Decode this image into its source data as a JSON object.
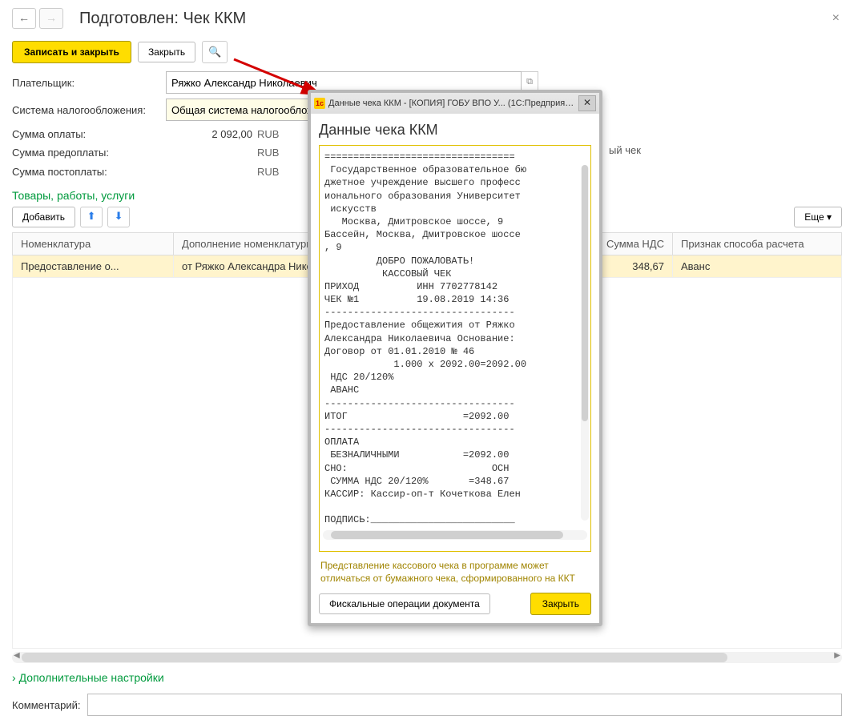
{
  "header": {
    "title": "Подготовлен: Чек ККМ"
  },
  "toolbar": {
    "save_close": "Записать и закрыть",
    "close": "Закрыть"
  },
  "form": {
    "payer_label": "Плательщик:",
    "payer_value": "Ряжко Александр Николаевич",
    "tax_label": "Система налогообложения:",
    "tax_value": "Общая система налогооблож",
    "sum_pay_label": "Сумма оплаты:",
    "sum_pay_value": "2 092,00",
    "cur": "RUB",
    "sum_prepay_label": "Сумма предоплаты:",
    "sum_postpay_label": "Сумма постоплаты:",
    "print_hint": "ый чек"
  },
  "section": {
    "goods": "Товары, работы, услуги",
    "add": "Добавить",
    "more": "Еще"
  },
  "table": {
    "h_nom": "Номенклатура",
    "h_dop": "Дополнение номенклатуры",
    "h_nds": "Сумма НДС",
    "h_prz": "Признак способа расчета",
    "r0_nom": "Предоставление о...",
    "r0_dop": "от Ряжко Александра Никола",
    "r0_nds": "348,67",
    "r0_prz": "Аванс"
  },
  "accordion": {
    "extra": "Дополнительные настройки"
  },
  "comment": {
    "label": "Комментарий:"
  },
  "modal": {
    "titlebar": "Данные чека ККМ - [КОПИЯ] ГОБУ ВПО У... (1С:Предприятие)",
    "heading": "Данные чека ККМ",
    "receipt": "=================================\n Государственное образовательное бю\nджетное учреждение высшего професс\nионального образования Университет\n искусств\n   Москва, Дмитровское шоссе, 9\nБассейн, Москва, Дмитровское шоссе\n, 9\n         ДОБРО ПОЖАЛОВАТЬ!\n          КАССОВЫЙ ЧЕК\nПРИХОД          ИНН 7702778142\nЧЕК №1          19.08.2019 14:36\n---------------------------------\nПредоставление общежития от Ряжко\nАлександра Николаевича Основание:\nДоговор от 01.01.2010 № 46\n            1.000 x 2092.00=2092.00\n НДС 20/120%\n АВАНС\n---------------------------------\nИТОГ                    =2092.00\n---------------------------------\nОПЛАТА\n БЕЗНАЛИЧНЫМИ           =2092.00\nСНО:                         ОСН\n СУММА НДС 20/120%       =348.67\nКАССИР: Кассир-оп-т Кочеткова Елен\n\nПОДПИСЬ:_________________________\n        СПАСИБО ЗА ПОКУПКУ!",
    "note": "Представление кассового чека в программе может отличаться от бумажного чека, сформированного на ККТ",
    "fisc": "Фискальные операции документа",
    "close": "Закрыть"
  }
}
